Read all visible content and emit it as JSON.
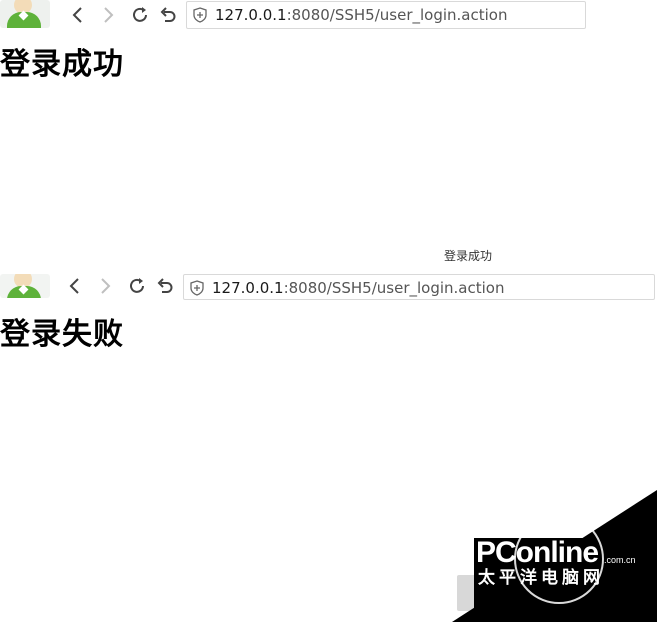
{
  "screens": [
    {
      "url_host": "127.0.0.1",
      "url_path": ":8080/SSH5/user_login.action",
      "heading": "登录成功"
    },
    {
      "url_host": "127.0.0.1",
      "url_path": ":8080/SSH5/user_login.action",
      "heading": "登录失败"
    }
  ],
  "caption": "登录成功",
  "watermark": {
    "brand": "PConline",
    "domain": ".com.cn",
    "tagline": "太平洋电脑网"
  },
  "colors": {
    "nav_icon": "#444444",
    "nav_icon_disabled": "#bfbfbf",
    "avatar_shirt": "#5eb23a"
  }
}
